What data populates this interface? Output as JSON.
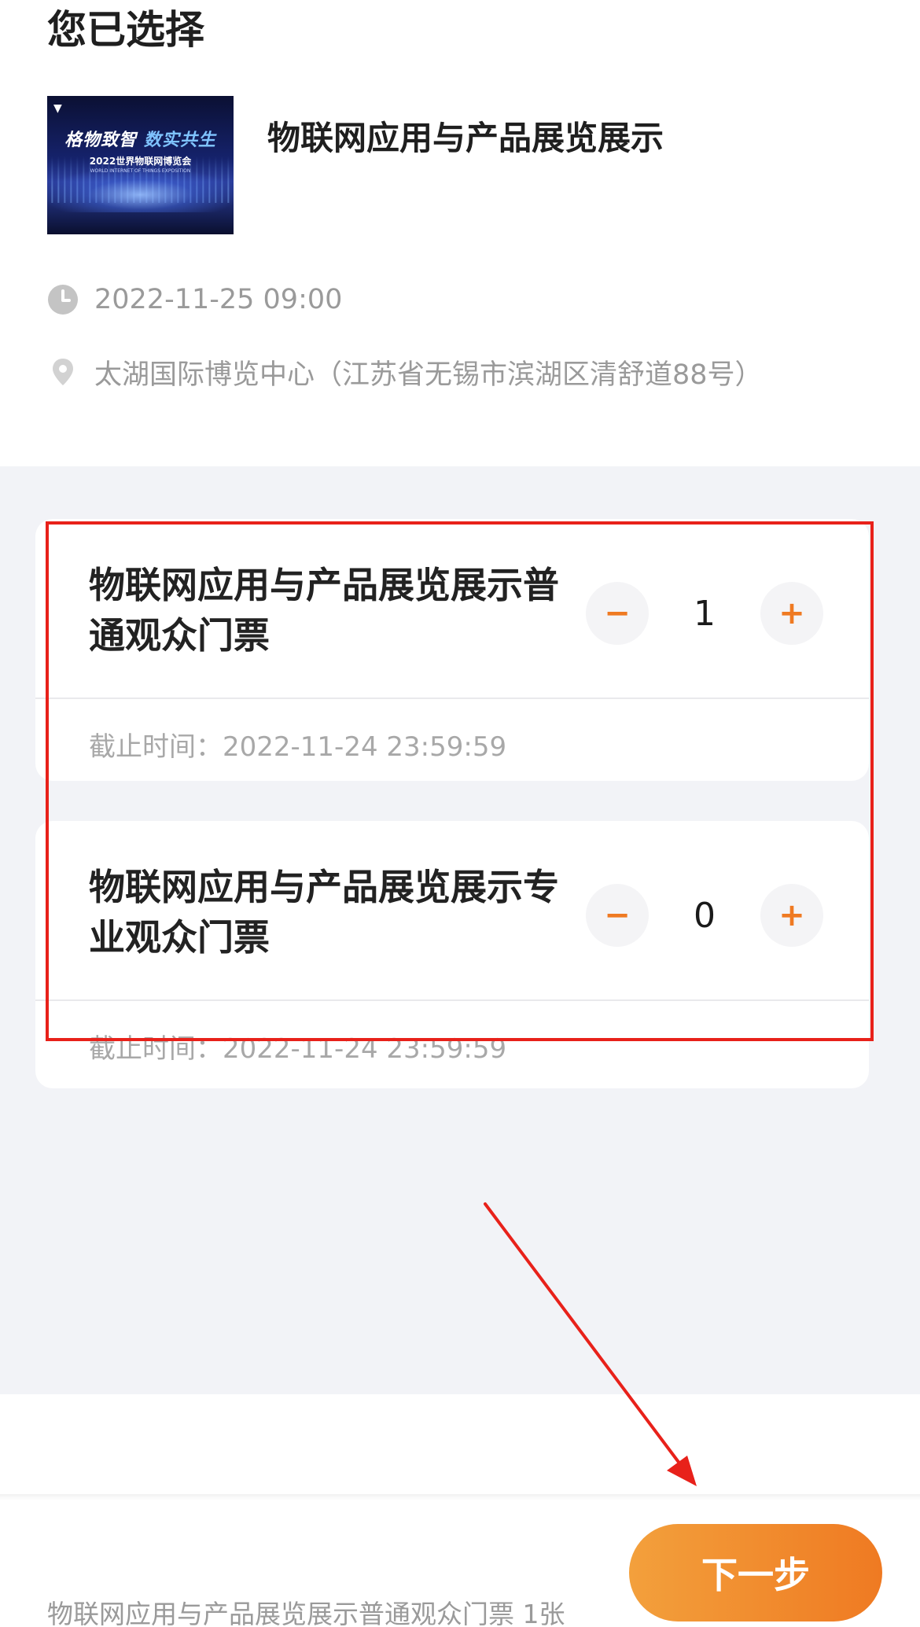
{
  "header": {
    "section_title": "您已选择"
  },
  "event": {
    "thumbnail": {
      "slogan_part1": "格物致智",
      "slogan_part2": "数实共生",
      "expo_title": "2022世界物联网博览会",
      "expo_en": "WORLD INTERNET OF THINGS EXPOSITION"
    },
    "name": "物联网应用与产品展览展示",
    "datetime": "2022-11-25 09:00",
    "location": "太湖国际博览中心（江苏省无锡市滨湖区清舒道88号）"
  },
  "tickets": [
    {
      "name": "物联网应用与产品展览展示普通观众门票",
      "quantity": "1",
      "minus_label": "−",
      "plus_label": "+",
      "deadline": "截止时间：2022-11-24 23:59:59"
    },
    {
      "name": "物联网应用与产品展览展示专业观众门票",
      "quantity": "0",
      "minus_label": "−",
      "plus_label": "+",
      "deadline": "截止时间：2022-11-24 23:59:59"
    }
  ],
  "footer": {
    "summary": "物联网应用与产品展览展示普通观众门票 1张",
    "next_label": "下一步"
  },
  "icons": {
    "clock": "clock-icon",
    "location": "location-pin-icon",
    "minus": "minus-icon",
    "plus": "plus-icon"
  },
  "colors": {
    "accent": "#ef7a22",
    "accent_light": "#f3a03c",
    "annotation_red": "#e8211a",
    "background_gray": "#f2f3f7"
  }
}
